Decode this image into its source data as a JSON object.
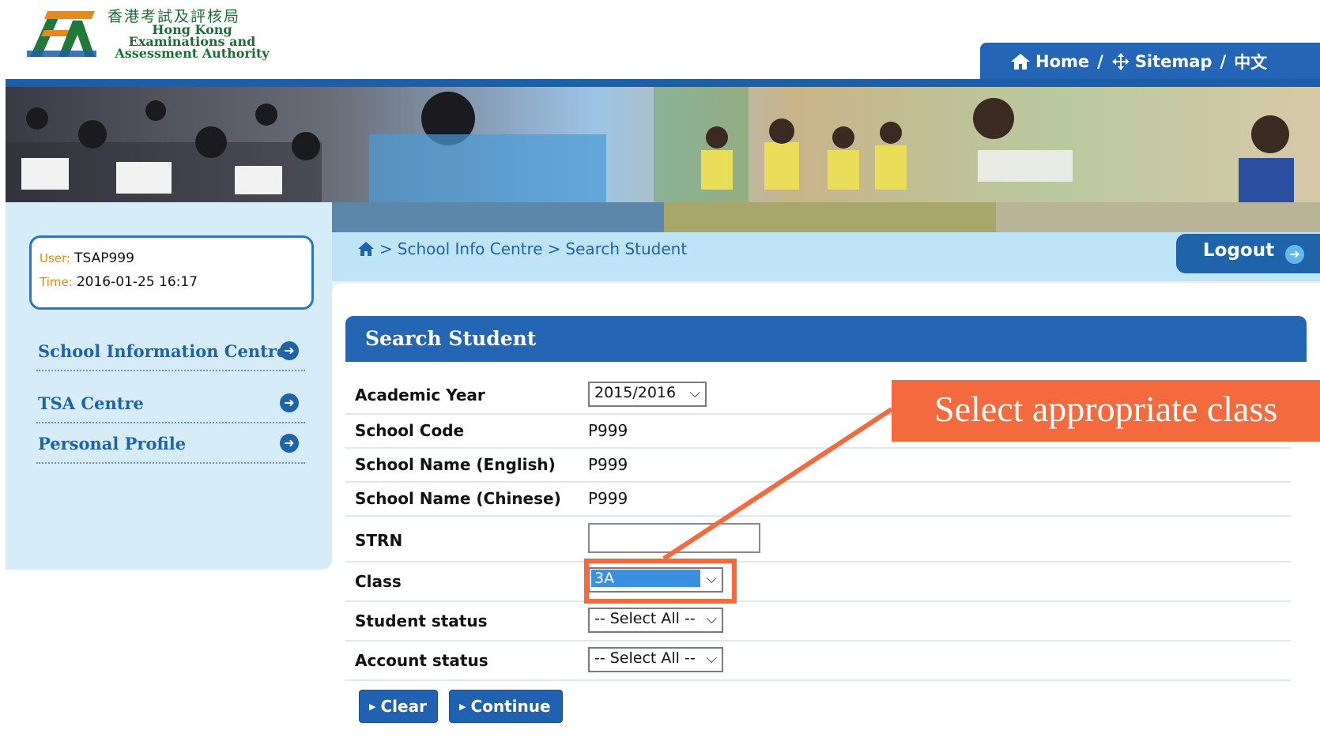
{
  "header": {
    "logo_cn": "香港考試及評核局",
    "logo_en_lines": [
      "Hong Kong",
      "Examinations and",
      "Assessment Authority"
    ],
    "topnav": {
      "home": "Home",
      "sep1": "/",
      "sitemap": "Sitemap",
      "sep2": "/",
      "lang": "中文"
    }
  },
  "user": {
    "user_label": "User:",
    "user_value": "TSAP999",
    "time_label": "Time:",
    "time_value": "2016-01-25 16:17"
  },
  "sidebar": {
    "items": [
      {
        "label": "School Information Centre"
      },
      {
        "label": "TSA Centre"
      },
      {
        "label": "Personal Profile"
      }
    ]
  },
  "breadcrumb": {
    "sep": ">",
    "items": [
      "School Info Centre",
      "Search Student"
    ]
  },
  "logout_label": "Logout",
  "panel": {
    "title": "Search Student",
    "fields": {
      "academic_year": {
        "label": "Academic Year",
        "value": "2015/2016"
      },
      "school_code": {
        "label": "School Code",
        "value": "P999"
      },
      "school_name_en": {
        "label": "School Name (English)",
        "value": "P999"
      },
      "school_name_cn": {
        "label": "School Name (Chinese)",
        "value": "P999"
      },
      "strn": {
        "label": "STRN",
        "value": ""
      },
      "class": {
        "label": "Class",
        "value": "3A"
      },
      "student_status": {
        "label": "Student status",
        "value": "-- Select All --"
      },
      "account_status": {
        "label": "Account status",
        "value": "-- Select All --"
      }
    },
    "buttons": {
      "clear": "Clear",
      "continue": "Continue"
    }
  },
  "annotation": {
    "text": "Select appropriate class"
  },
  "colors": {
    "primary_blue": "#2566b4",
    "annotation_orange": "#f26a3e",
    "label_orange": "#e08a12"
  }
}
